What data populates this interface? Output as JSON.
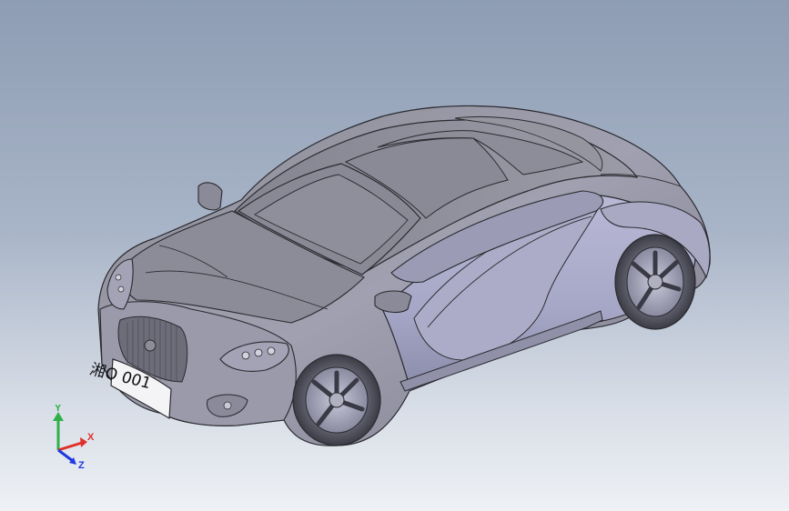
{
  "model": {
    "plate_text": "湘O 001"
  },
  "triad": {
    "x_label": "X",
    "y_label": "Y",
    "z_label": "Z",
    "x_color": "#e0302a",
    "y_color": "#2fb04a",
    "z_color": "#1e3ae0"
  }
}
